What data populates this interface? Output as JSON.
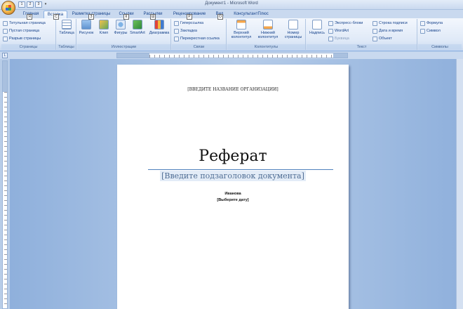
{
  "window": {
    "title": "Документ1 - Microsoft Word"
  },
  "qat": {
    "keytips": [
      "1",
      "2",
      "3"
    ]
  },
  "tabs": [
    {
      "label": "Главная",
      "keytip": "Я"
    },
    {
      "label": "Вставка",
      "keytip": "С"
    },
    {
      "label": "Разметка страницы",
      "keytip": "З"
    },
    {
      "label": "Ссылки",
      "keytip": "К"
    },
    {
      "label": "Рассылки",
      "keytip": "Ш"
    },
    {
      "label": "Рецензирование",
      "keytip": "Р"
    },
    {
      "label": "Вид",
      "keytip": "О"
    },
    {
      "label": "КонсультантПлюс",
      "keytip": ""
    }
  ],
  "ribbon": {
    "pages": {
      "label": "Страницы",
      "items": [
        "Титульная страница",
        "Пустая страница",
        "Разрыв страницы"
      ]
    },
    "tables": {
      "label": "Таблицы",
      "item": "Таблица"
    },
    "illustrations": {
      "label": "Иллюстрации",
      "items": [
        "Рисунок",
        "Клип",
        "Фигуры",
        "SmartArt",
        "Диаграмма"
      ]
    },
    "links": {
      "label": "Связи",
      "items": [
        "Гиперссылка",
        "Закладка",
        "Перекрестная ссылка"
      ]
    },
    "headers": {
      "label": "Колонтитулы",
      "items": [
        "Верхний колонтитул",
        "Нижний колонтитул",
        "Номер страницы"
      ]
    },
    "text": {
      "label": "Текст",
      "items": [
        "Надпись",
        "Экспресс-блоки",
        "WordArt",
        "Буквица",
        "Строка подписи",
        "Дата и время",
        "Объект"
      ]
    },
    "symbols": {
      "label": "Символы",
      "items": [
        "Формула",
        "Символ"
      ]
    }
  },
  "ruler": {
    "corner": "L"
  },
  "document": {
    "org": "[ВВЕДИТЕ НАЗВАНИЕ ОРГАНИЗАЦИИ]",
    "title": "Реферат",
    "subtitle": "[Введите подзаголовок документа]",
    "author": "Иванова",
    "date": "[Выберите дату]"
  }
}
